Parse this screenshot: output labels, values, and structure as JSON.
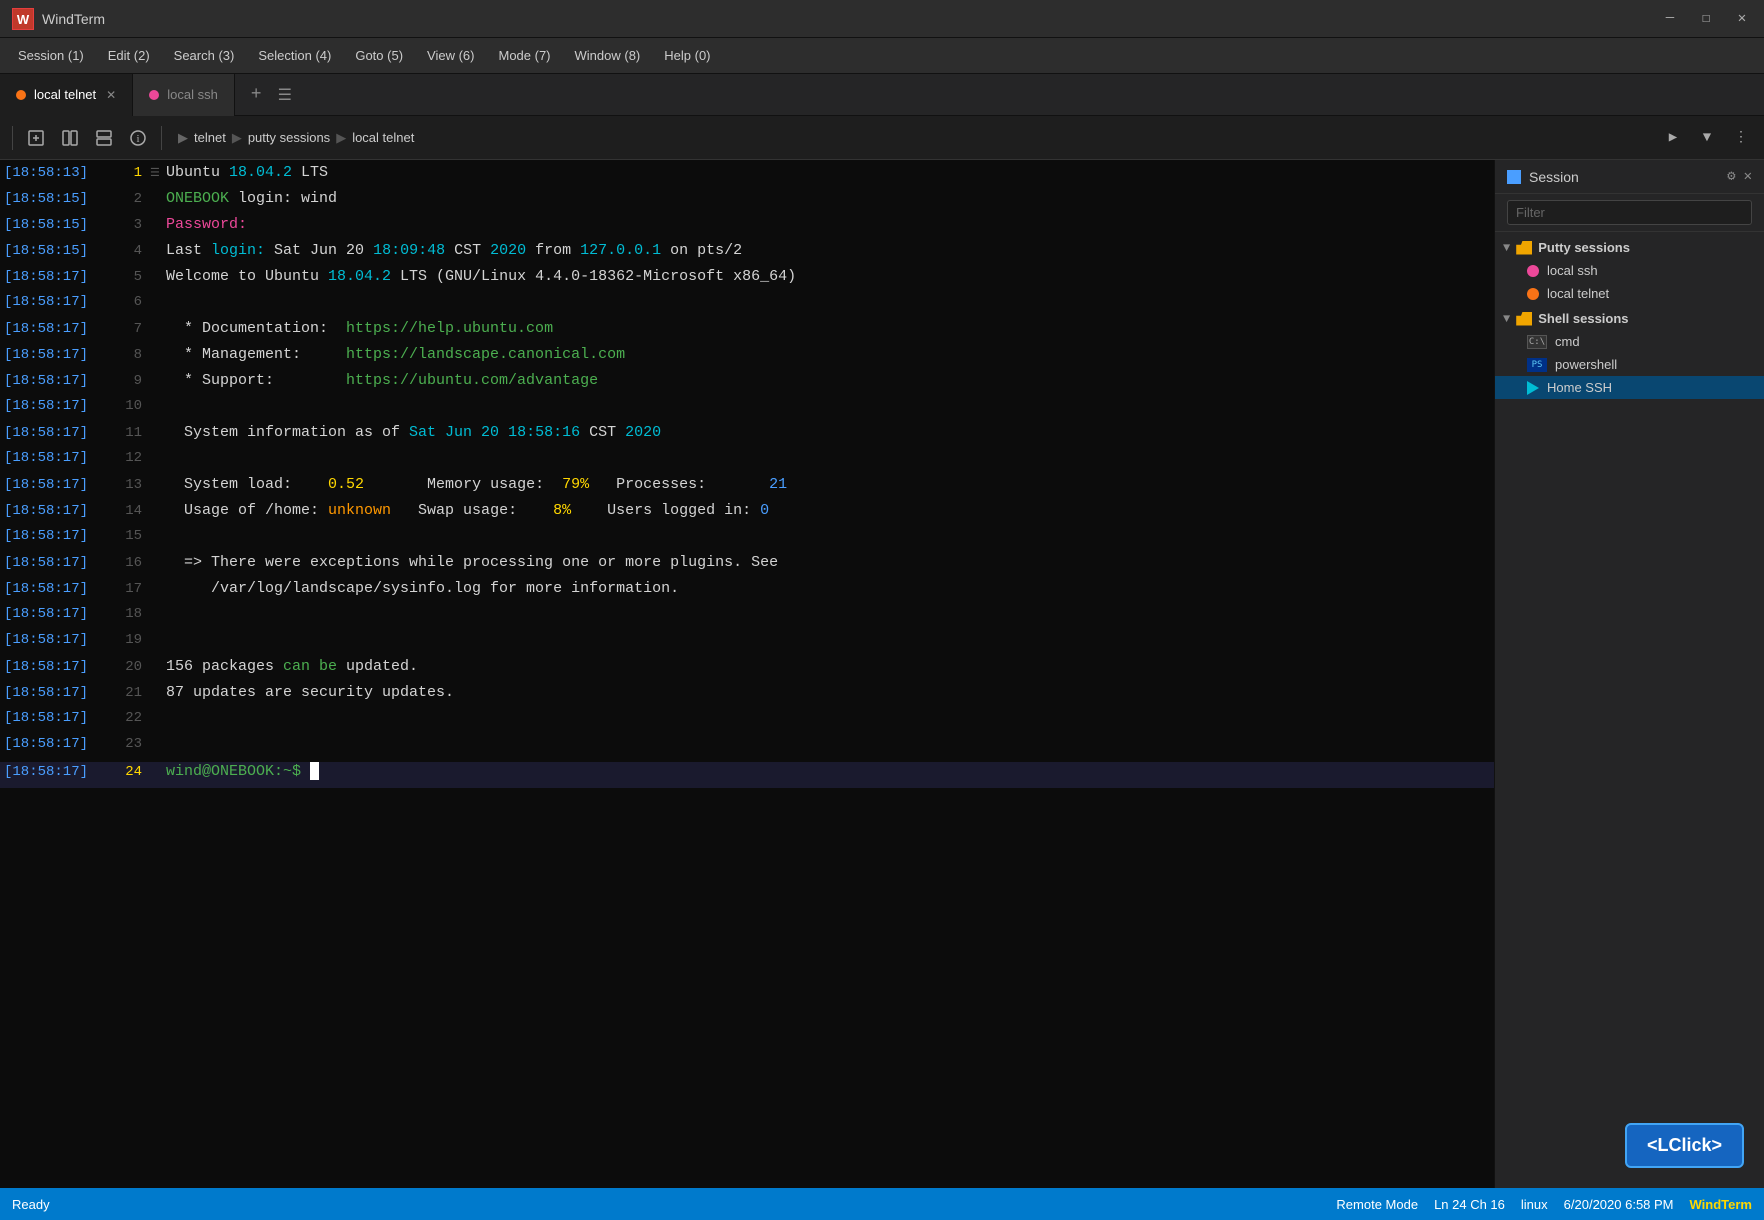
{
  "titlebar": {
    "logo": "W",
    "title": "WindTerm",
    "minimize": "—",
    "restore": "☐",
    "close": "✕"
  },
  "menubar": {
    "items": [
      "Session (1)",
      "Edit (2)",
      "Search (3)",
      "Selection (4)",
      "Goto (5)",
      "View (6)",
      "Mode (7)",
      "Window (8)",
      "Help (0)"
    ]
  },
  "tabs": {
    "tab1_label": "local telnet",
    "tab2_label": "local ssh",
    "add": "+",
    "menu": "☰"
  },
  "toolbar": {
    "breadcrumb": [
      "telnet",
      "putty sessions",
      "local telnet"
    ]
  },
  "terminal": {
    "lines": [
      {
        "ts": "[18:58:13]",
        "num": "1",
        "active_icon": true,
        "content": "Ubuntu 18.04.2 LTS"
      },
      {
        "ts": "[18:58:15]",
        "num": "2",
        "content": "ONEBOOK login: wind"
      },
      {
        "ts": "[18:58:15]",
        "num": "3",
        "content": "Password:"
      },
      {
        "ts": "[18:58:15]",
        "num": "4",
        "content": "Last login: Sat Jun 20 18:09:48 CST 2020 from 127.0.0.1 on pts/2"
      },
      {
        "ts": "[18:58:17]",
        "num": "5",
        "content": "Welcome to Ubuntu 18.04.2 LTS (GNU/Linux 4.4.0-18362-Microsoft x86_64)"
      },
      {
        "ts": "[18:58:17]",
        "num": "6",
        "content": ""
      },
      {
        "ts": "[18:58:17]",
        "num": "7",
        "content": "  * Documentation:  https://help.ubuntu.com"
      },
      {
        "ts": "[18:58:17]",
        "num": "8",
        "content": "  * Management:     https://landscape.canonical.com"
      },
      {
        "ts": "[18:58:17]",
        "num": "9",
        "content": "  * Support:        https://ubuntu.com/advantage"
      },
      {
        "ts": "[18:58:17]",
        "num": "10",
        "content": ""
      },
      {
        "ts": "[18:58:17]",
        "num": "11",
        "content": "  System information as of Sat Jun 20 18:58:16 CST 2020"
      },
      {
        "ts": "[18:58:17]",
        "num": "12",
        "content": ""
      },
      {
        "ts": "[18:58:17]",
        "num": "13",
        "content": "  System load:    0.52       Memory usage:  79%   Processes:       21"
      },
      {
        "ts": "[18:58:17]",
        "num": "14",
        "content": "  Usage of /home: unknown   Swap usage:    8%    Users logged in: 0"
      },
      {
        "ts": "[18:58:17]",
        "num": "15",
        "content": ""
      },
      {
        "ts": "[18:58:17]",
        "num": "16",
        "content": "  => There were exceptions while processing one or more plugins. See"
      },
      {
        "ts": "[18:58:17]",
        "num": "17",
        "content": "     /var/log/landscape/sysinfo.log for more information."
      },
      {
        "ts": "[18:58:17]",
        "num": "18",
        "content": ""
      },
      {
        "ts": "[18:58:17]",
        "num": "19",
        "content": ""
      },
      {
        "ts": "[18:58:17]",
        "num": "20",
        "content": "156 packages can be updated."
      },
      {
        "ts": "[18:58:17]",
        "num": "21",
        "content": "87 updates are security updates."
      },
      {
        "ts": "[18:58:17]",
        "num": "22",
        "content": ""
      },
      {
        "ts": "[18:58:17]",
        "num": "23",
        "content": ""
      },
      {
        "ts": "[18:58:17]",
        "num": "24",
        "content": "wind@ONEBOOK:~$ ",
        "is_prompt": true
      }
    ]
  },
  "sidebar": {
    "header_title": "Session",
    "filter_placeholder": "Filter",
    "groups": [
      {
        "label": "Putty sessions",
        "expanded": true,
        "items": [
          {
            "label": "local ssh",
            "type": "dot-pink"
          },
          {
            "label": "local telnet",
            "type": "dot-orange"
          }
        ]
      },
      {
        "label": "Shell sessions",
        "expanded": true,
        "items": [
          {
            "label": "cmd",
            "type": "cmd"
          },
          {
            "label": "powershell",
            "type": "ps"
          },
          {
            "label": "Home SSH",
            "type": "ssh"
          }
        ]
      }
    ]
  },
  "statusbar": {
    "ready": "Ready",
    "remote_mode": "Remote Mode",
    "position": "Ln 24 Ch 16",
    "os": "linux",
    "datetime": "6/20/2020  6:58 PM",
    "app": "WindTerm"
  },
  "lclick": "<LClick>"
}
